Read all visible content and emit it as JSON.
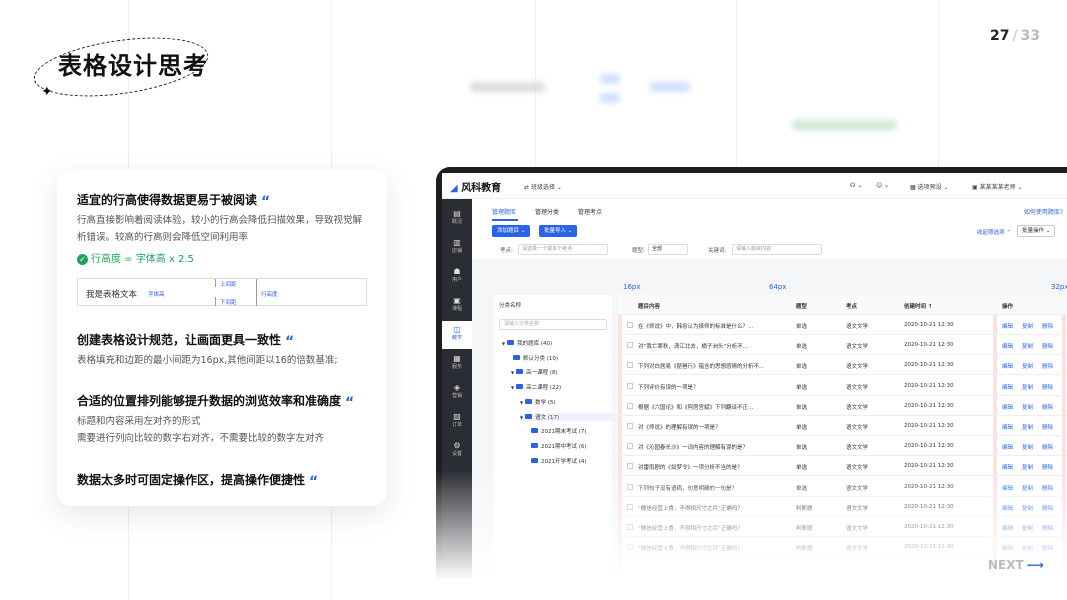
{
  "title": "表格设计思考",
  "page": {
    "current": "27",
    "separator": "/",
    "total": "33"
  },
  "card": {
    "s1": {
      "heading": "适宜的行高使得数据更易于被阅读",
      "quote": "“",
      "body": "行高直接影响着阅读体验，较小的行高会降低扫描效果，导致视觉解析错误。较高的行高则会降低空间利用率",
      "formula": "行高度 = 字体高 x 2.5"
    },
    "demo": {
      "text": "我是表格文本",
      "font_label": "字体高",
      "top_label": "上间距",
      "bottom_label": "下间距",
      "row_label": "行高度"
    },
    "s2": {
      "heading": "创建表格设计规范，让画面更具一致性",
      "quote": "“",
      "body": "表格填充和边距的最小间距为16px,其他间距以16的倍数基准;"
    },
    "s3": {
      "heading": "合适的位置排列能够提升数据的浏览效率和准确度",
      "quote": "“",
      "body1": "标题和内容采用左对齐的形式",
      "body2": "需要进行列向比较的数字右对齐，不需要比较的数字左对齐"
    },
    "s4": {
      "heading": "数据太多时可固定操作区，提高操作便捷性",
      "quote": "“"
    }
  },
  "app": {
    "logo": "风科教育",
    "switch": "班级选择",
    "nav_right": [
      "选项预设",
      "某某某某老师"
    ],
    "sidebar": [
      {
        "icon": "▤",
        "label": "概况"
      },
      {
        "icon": "▥",
        "label": "店铺"
      },
      {
        "icon": "☗",
        "label": "用户"
      },
      {
        "icon": "▣",
        "label": "课程"
      },
      {
        "icon": "◫",
        "label": "教学"
      },
      {
        "icon": "▦",
        "label": "服务"
      },
      {
        "icon": "◈",
        "label": "营销"
      },
      {
        "icon": "▧",
        "label": "订单"
      },
      {
        "icon": "⚙",
        "label": "设置"
      }
    ],
    "tabs": [
      "管理题库",
      "管理分类",
      "管理考点"
    ],
    "help": "如何使用题库?",
    "add_btn": "添加题目 ⌄",
    "import_btn": "批量导入 ⌄",
    "collapse": "收起筛选项 ⌃",
    "batch": "批量操作 ⌄",
    "filters": {
      "kp_label": "考点:",
      "kp_ph": "请选择一个或多个考点",
      "type_label": "题型:",
      "type_val": "全部",
      "kw_label": "关键词:",
      "kw_ph": "请输入题目内容"
    },
    "spacing": [
      "16px",
      "64px",
      "32px"
    ],
    "tree": {
      "header": "分类名称",
      "search": "请输入分类名称",
      "nodes": [
        {
          "label": "我的题库 (40)",
          "indent": 0
        },
        {
          "label": "默认分类 (10)",
          "indent": 1
        },
        {
          "label": "高一课程 (8)",
          "indent": 1
        },
        {
          "label": "高二课程 (22)",
          "indent": 1
        },
        {
          "label": "数学 (5)",
          "indent": 2
        },
        {
          "label": "语文 (17)",
          "indent": 2
        },
        {
          "label": "2021期末考试 (7)",
          "indent": 3
        },
        {
          "label": "2021期中考试 (6)",
          "indent": 3
        },
        {
          "label": "2021开学考试 (4)",
          "indent": 3
        }
      ]
    },
    "table": {
      "headers": [
        "题目内容",
        "题型",
        "考点",
        "创建时间 ↑",
        "操作"
      ],
      "rows": [
        {
          "content": "在《师说》中，韩愈认为择师的标准是什么？...",
          "type": "单选",
          "kp": "语文文学",
          "time": "2020-10-21 12:30"
        },
        {
          "content": "对“我亡寒秋，潇江北去，橘子洲头”分析不...",
          "type": "单选",
          "kp": "语文文学",
          "time": "2020-10-21 12:30"
        },
        {
          "content": "下列对白居易《琵琶行》蕴含的思想感情的分析不...",
          "type": "单选",
          "kp": "语文文学",
          "time": "2020-10-21 12:30"
        },
        {
          "content": "下列评价有误的一项是？",
          "type": "单选",
          "kp": "语文文学",
          "time": "2020-10-21 12:30"
        },
        {
          "content": "根据《六国论》和《阿房宫赋》下列翻译不正...",
          "type": "单选",
          "kp": "语文文学",
          "time": "2020-10-21 12:30"
        },
        {
          "content": "对《师说》的理解有误的一项是？",
          "type": "单选",
          "kp": "语文文学",
          "time": "2020-10-21 12:30"
        },
        {
          "content": "对《沁园春长沙》一词内容的理解有误的是？",
          "type": "单选",
          "kp": "语文文学",
          "time": "2020-10-21 12:30"
        },
        {
          "content": "对雷雨剧的《如梦令》一项分析不当的是？",
          "type": "单选",
          "kp": "语文文学",
          "time": "2020-10-21 12:30"
        },
        {
          "content": "下列句子没有语病，句意明确的一句是？",
          "type": "单选",
          "kp": "语文文学",
          "time": "2020-10-21 12:30"
        },
        {
          "content": "“微信经营上食，不得相尺寸之兵”正确吗？",
          "type": "判断题",
          "kp": "语文文学",
          "time": "2020-10-21 12:30"
        },
        {
          "content": "“微信经营上食，不得相尺寸之兵”正确吗？",
          "type": "判断题",
          "kp": "语文文学",
          "time": "2020-10-21 12:30"
        },
        {
          "content": "“微信经营上食，不得相尺寸之兵”正确吗？",
          "type": "判断题",
          "kp": "语文文学",
          "time": "2020-10-21 12:30"
        }
      ],
      "actions": [
        "编辑",
        "复制",
        "删除"
      ]
    }
  },
  "next": "NEXT",
  "colors": {
    "accent": "#2b63e6",
    "green": "#21a35b"
  }
}
